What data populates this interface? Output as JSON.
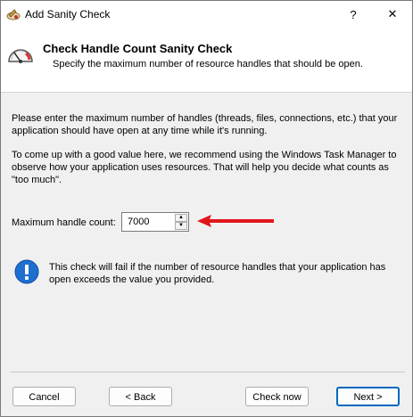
{
  "window": {
    "title": "Add Sanity Check",
    "help_glyph": "?",
    "close_glyph": "✕",
    "icons": [
      "app-icon",
      "help-icon",
      "close-icon"
    ]
  },
  "header": {
    "title": "Check Handle Count Sanity Check",
    "subtitle": "Specify the maximum number of resource handles that should be open.",
    "icon": "gauge-icon"
  },
  "body": {
    "paragraph1": "Please enter the maximum number of handles (threads, files, connections, etc.) that your application should have open at any time while it's running.",
    "paragraph2": "To come up with a good value here, we recommend using the Windows Task Manager to observe how your application uses resources. That will help you decide what counts as \"too much\".",
    "field_label": "Maximum handle count:",
    "field_value": "7000",
    "spin_up_glyph": "▲",
    "spin_down_glyph": "▼",
    "annotation_color": "#e0161b",
    "info_icon": "info-icon",
    "info_text": "This check will fail if the number of resource handles that your application has open exceeds the value you provided."
  },
  "buttons": {
    "cancel": "Cancel",
    "back": "< Back",
    "check_now": "Check now",
    "next": "Next >"
  },
  "colors": {
    "accent": "#0067c0",
    "info_blue": "#1e6fd0",
    "arrow_red": "#e0161b"
  }
}
